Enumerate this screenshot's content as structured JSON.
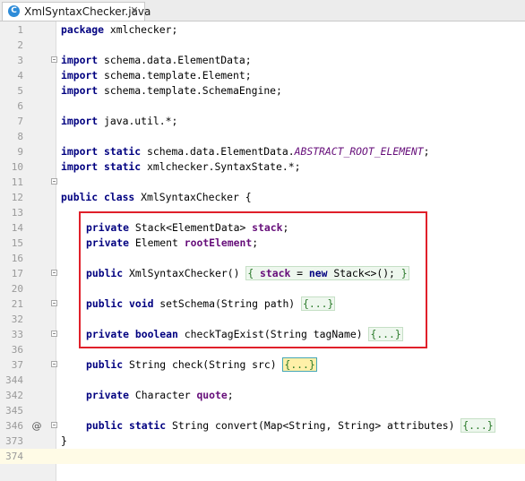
{
  "tab": {
    "icon_letter": "C",
    "file_name": "XmlSyntaxChecker.java",
    "close_glyph": "✕"
  },
  "gutter": {
    "override_marker": "@"
  },
  "lines": [
    {
      "num": "1",
      "tokens": [
        [
          "kw",
          "package"
        ],
        [
          "t",
          " xmlchecker;"
        ]
      ]
    },
    {
      "num": "2",
      "tokens": []
    },
    {
      "num": "3",
      "tokens": [
        [
          "kw",
          "import"
        ],
        [
          "t",
          " schema.data.ElementData;"
        ]
      ]
    },
    {
      "num": "4",
      "tokens": [
        [
          "kw",
          "import"
        ],
        [
          "t",
          " schema.template.Element;"
        ]
      ]
    },
    {
      "num": "5",
      "tokens": [
        [
          "kw",
          "import"
        ],
        [
          "t",
          " schema.template.SchemaEngine;"
        ]
      ]
    },
    {
      "num": "6",
      "tokens": []
    },
    {
      "num": "7",
      "tokens": [
        [
          "kw",
          "import"
        ],
        [
          "t",
          " java.util.*;"
        ]
      ]
    },
    {
      "num": "8",
      "tokens": []
    },
    {
      "num": "9",
      "tokens": [
        [
          "kw",
          "import static"
        ],
        [
          "t",
          " schema.data.ElementData."
        ],
        [
          "stat",
          "ABSTRACT_ROOT_ELEMENT"
        ],
        [
          "t",
          ";"
        ]
      ]
    },
    {
      "num": "10",
      "tokens": [
        [
          "kw",
          "import static"
        ],
        [
          "t",
          " xmlchecker.SyntaxState.*;"
        ]
      ]
    },
    {
      "num": "11",
      "tokens": []
    },
    {
      "num": "12",
      "tokens": [
        [
          "kw",
          "public class"
        ],
        [
          "t",
          " XmlSyntaxChecker {"
        ]
      ]
    },
    {
      "num": "13",
      "tokens": []
    },
    {
      "num": "14",
      "tokens": [
        [
          "kw",
          "private"
        ],
        [
          "t",
          " Stack<ElementData> "
        ],
        [
          "fld",
          "stack"
        ],
        [
          "t",
          ";"
        ]
      ]
    },
    {
      "num": "15",
      "tokens": [
        [
          "kw",
          "private"
        ],
        [
          "t",
          " Element "
        ],
        [
          "fld",
          "rootElement"
        ],
        [
          "t",
          ";"
        ]
      ]
    },
    {
      "num": "16",
      "tokens": []
    },
    {
      "num": "17",
      "tokens": [
        [
          "kw",
          "public"
        ],
        [
          "t",
          " XmlSyntaxChecker() "
        ],
        [
          "fbopen",
          "{ "
        ],
        [
          "fld",
          "stack"
        ],
        [
          "fbmid",
          " = "
        ],
        [
          "kw",
          "new"
        ],
        [
          "fbclose",
          " Stack<>(); }"
        ]
      ]
    },
    {
      "num": "20",
      "tokens": []
    },
    {
      "num": "21",
      "tokens": [
        [
          "kw",
          "public void"
        ],
        [
          "t",
          " setSchema(String path) "
        ],
        [
          "fb",
          "{...}"
        ]
      ]
    },
    {
      "num": "32",
      "tokens": []
    },
    {
      "num": "33",
      "tokens": [
        [
          "kw",
          "private boolean"
        ],
        [
          "t",
          " checkTagExist(String tagName) "
        ],
        [
          "fb",
          "{...}"
        ]
      ]
    },
    {
      "num": "36",
      "tokens": []
    },
    {
      "num": "37",
      "tokens": [
        [
          "kw",
          "public"
        ],
        [
          "t",
          " String check(String src) "
        ],
        [
          "fbsel",
          "{...}"
        ]
      ]
    },
    {
      "num": "344",
      "tokens": []
    },
    {
      "num": "342",
      "tokens": [
        [
          "kw",
          "private"
        ],
        [
          "t",
          " Character "
        ],
        [
          "fld",
          "quote"
        ],
        [
          "t",
          ";"
        ]
      ]
    },
    {
      "num": "345",
      "tokens": []
    },
    {
      "num": "346",
      "tokens": [
        [
          "kw",
          "public static"
        ],
        [
          "t",
          " String convert(Map<String, String> attributes) "
        ],
        [
          "fb",
          "{...}"
        ]
      ]
    },
    {
      "num": "373",
      "tokens": [
        [
          "t",
          "}"
        ]
      ]
    },
    {
      "num": "374",
      "tokens": []
    }
  ]
}
